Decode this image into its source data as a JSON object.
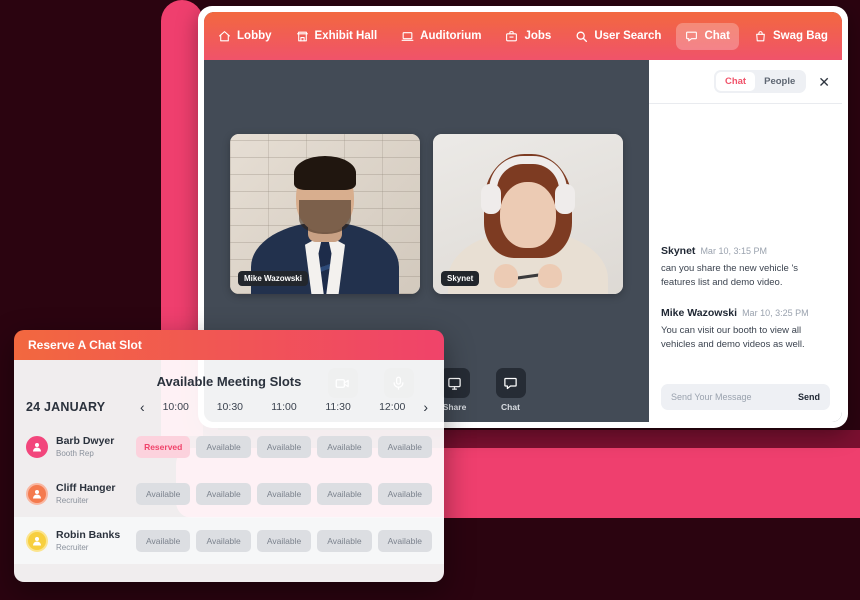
{
  "nav": {
    "items": [
      {
        "label": "Lobby",
        "icon": "home-icon",
        "active": false
      },
      {
        "label": "Exhibit Hall",
        "icon": "store-icon",
        "active": false
      },
      {
        "label": "Auditorium",
        "icon": "laptop-icon",
        "active": false
      },
      {
        "label": "Jobs",
        "icon": "briefcase-icon",
        "active": false
      },
      {
        "label": "User Search",
        "icon": "search-icon",
        "active": false
      },
      {
        "label": "Chat",
        "icon": "chat-bubble-icon",
        "active": true
      },
      {
        "label": "Swag Bag",
        "icon": "bag-icon",
        "active": false
      }
    ]
  },
  "stage": {
    "tiles": [
      {
        "name": "Mike Wazowski"
      },
      {
        "name": "Skynet"
      }
    ],
    "controls": [
      {
        "label": "Cam",
        "icon": "video-camera-icon"
      },
      {
        "label": "Mic",
        "icon": "microphone-icon"
      },
      {
        "label": "Share",
        "icon": "monitor-icon"
      },
      {
        "label": "Chat",
        "icon": "chat-bubble-icon"
      }
    ]
  },
  "chat": {
    "tabs": [
      {
        "label": "Chat",
        "active": true
      },
      {
        "label": "People",
        "active": false
      }
    ],
    "close_label": "✕",
    "messages": [
      {
        "author": "Skynet",
        "time": "Mar 10, 3:15 PM",
        "text": "can you share the new vehicle 's features list and demo video."
      },
      {
        "author": "Mike Wazowski",
        "time": "Mar 10, 3:25 PM",
        "text": "You can visit our booth to view all vehicles and demo videos as well."
      }
    ],
    "composer": {
      "placeholder": "Send Your Message",
      "value": "",
      "send_label": "Send"
    }
  },
  "modal": {
    "header_title": "Reserve A Chat Slot",
    "title": "Available Meeting Slots",
    "date": "24 JANUARY",
    "prev_label": "‹",
    "next_label": "›",
    "times": [
      "10:00",
      "10:30",
      "11:00",
      "11:30",
      "12:00"
    ],
    "rows": [
      {
        "name": "Barb Dwyer",
        "role": "Booth Rep",
        "avatar_color": "#f2467c",
        "slots": [
          "Reserved",
          "Available",
          "Available",
          "Available",
          "Available"
        ]
      },
      {
        "name": "Cliff Hanger",
        "role": "Recruiter",
        "avatar_color": "#f47a4e",
        "slots": [
          "Available",
          "Available",
          "Available",
          "Available",
          "Available"
        ]
      },
      {
        "name": "Robin Banks",
        "role": "Recruiter",
        "avatar_color": "#f7cf3f",
        "slots": [
          "Available",
          "Available",
          "Available",
          "Available",
          "Available"
        ]
      }
    ]
  },
  "colors": {
    "brand_orange": "#f2683f",
    "brand_pink": "#f0436a",
    "accent_pink": "#ef3f6e",
    "background_dark": "#2b0410",
    "stage_slate": "#434b56"
  }
}
